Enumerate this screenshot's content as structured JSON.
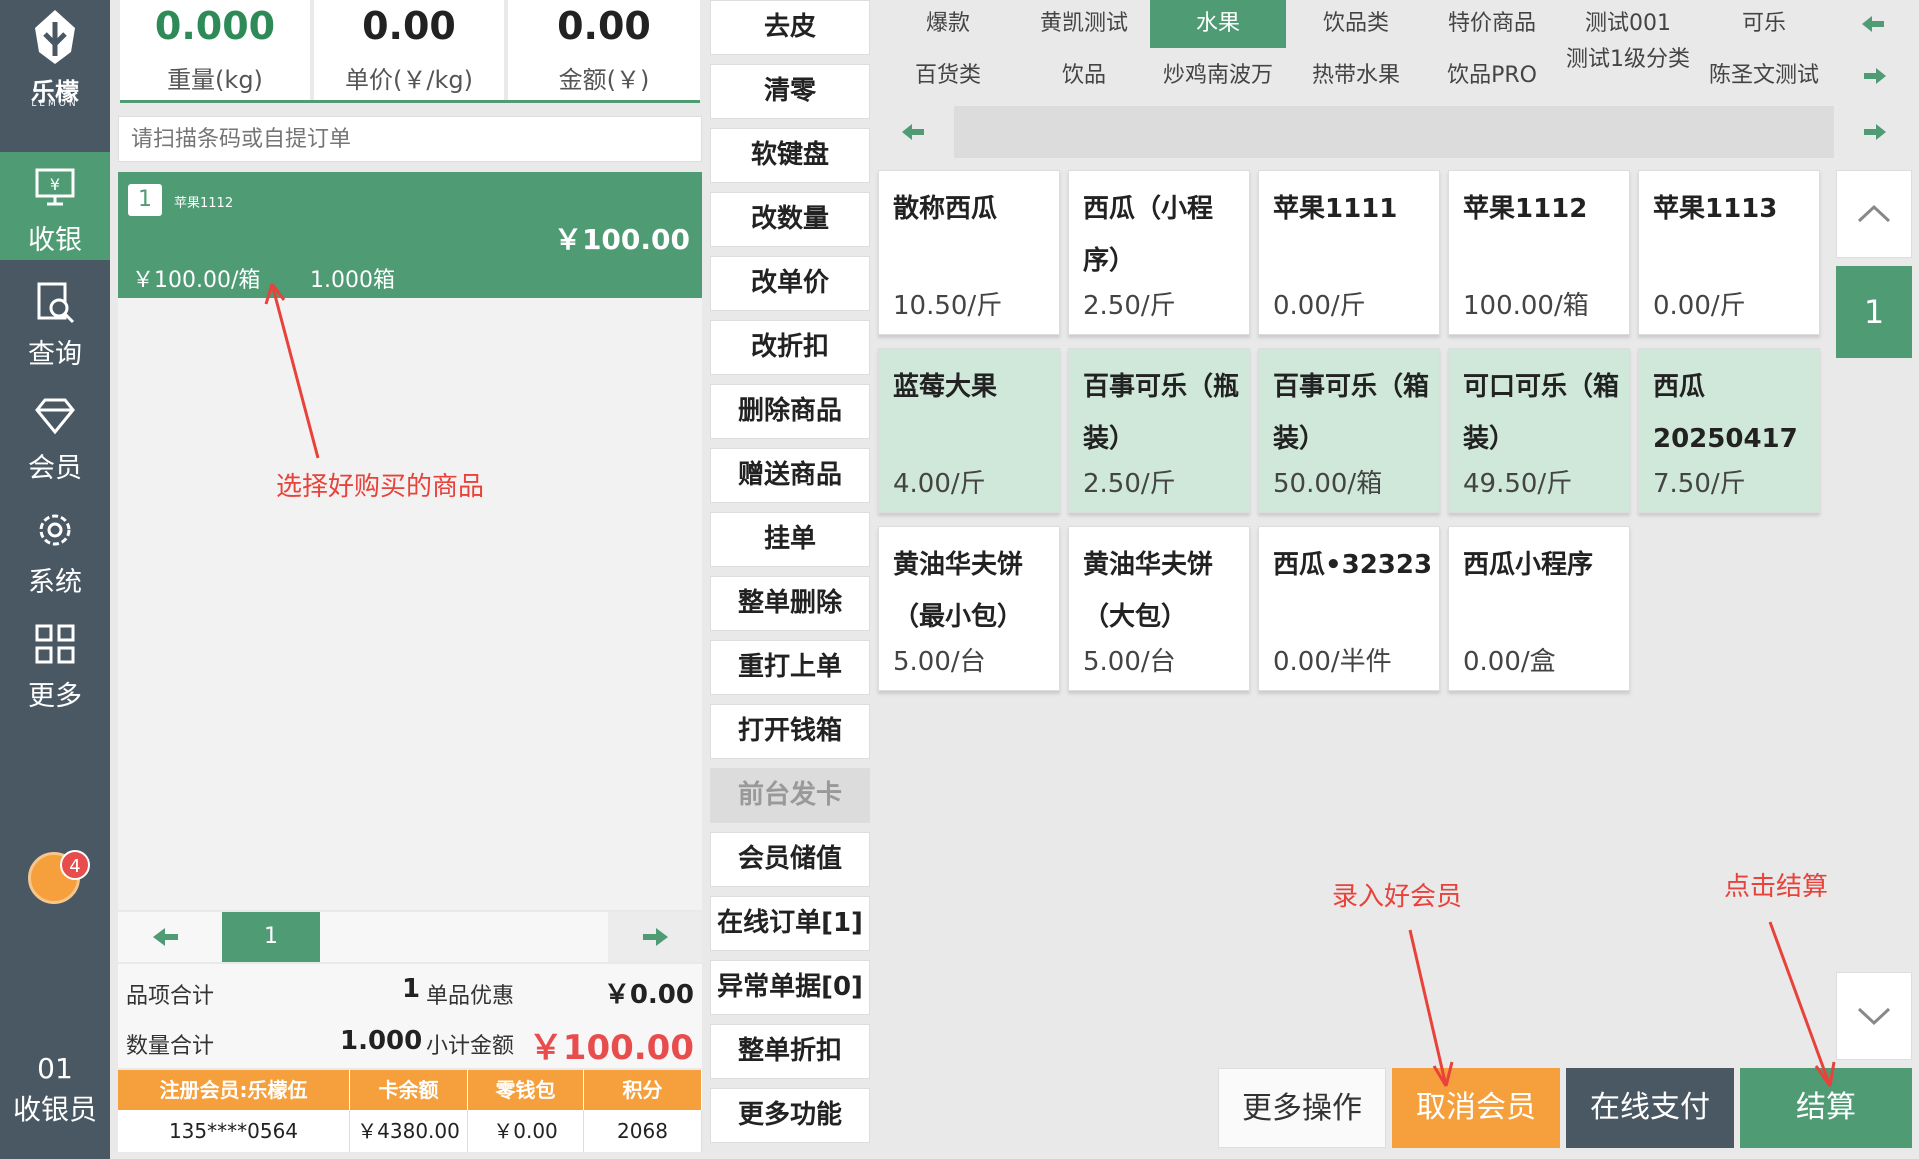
{
  "brand": {
    "name_cn": "乐檬",
    "name_en": "LEMON"
  },
  "nav": [
    {
      "label": "收银",
      "icon": "cashier-icon"
    },
    {
      "label": "查询",
      "icon": "query-icon"
    },
    {
      "label": "会员",
      "icon": "member-icon"
    },
    {
      "label": "系统",
      "icon": "settings-icon"
    },
    {
      "label": "更多",
      "icon": "more-icon"
    }
  ],
  "notification": {
    "count": "4"
  },
  "cashier": {
    "number": "01",
    "label": "收银员"
  },
  "metrics": {
    "weight": {
      "value": "0.000",
      "label": "重量(kg)"
    },
    "unit_price": {
      "value": "0.00",
      "label": "单价(￥/kg)"
    },
    "amount": {
      "value": "0.00",
      "label": "金额(￥)"
    }
  },
  "scan": {
    "placeholder": "请扫描条码或自提订单"
  },
  "order_item": {
    "index": "1",
    "name": "苹果1112",
    "total": "￥100.00",
    "price": "￥100.00/箱",
    "qty": "1.000箱"
  },
  "order_pager": {
    "page": "1"
  },
  "summary": {
    "items_label": "品项合计",
    "items_value": "1",
    "discount_label": "单品优惠",
    "discount_value": "￥0.00",
    "qty_label": "数量合计",
    "qty_value": "1.000",
    "subtotal_label": "小计金额",
    "subtotal_value": "￥100.00"
  },
  "member": {
    "headers": [
      "注册会员:乐檬伍",
      "卡余额",
      "零钱包",
      "积分"
    ],
    "values": [
      "135****0564",
      "￥4380.00",
      "￥0.00",
      "2068"
    ]
  },
  "functions": [
    "去皮",
    "清零",
    "软键盘",
    "改数量",
    "改单价",
    "改折扣",
    "删除商品",
    "赠送商品",
    "挂单",
    "整单删除",
    "重打上单",
    "打开钱箱",
    "前台发卡",
    "会员储值",
    "在线订单[1]",
    "异常单据[0]",
    "整单折扣",
    "更多功能"
  ],
  "categories_row1": [
    "爆款",
    "黄凯测试",
    "水果",
    "饮品类",
    "特价商品",
    "测试001",
    "可乐"
  ],
  "categories_row2": [
    "百货类",
    "饮品",
    "炒鸡南波万",
    "热带水果",
    "饮品PRO",
    "测试1级分类",
    "陈圣文测试"
  ],
  "products": [
    {
      "name": "散称西瓜",
      "price": "10.50/斤"
    },
    {
      "name": "西瓜（小程序）",
      "price": "2.50/斤"
    },
    {
      "name": "苹果1111",
      "price": "0.00/斤"
    },
    {
      "name": "苹果1112",
      "price": "100.00/箱"
    },
    {
      "name": "苹果1113",
      "price": "0.00/斤"
    },
    {
      "name": "蓝莓大果",
      "price": "4.00/斤"
    },
    {
      "name": "百事可乐（瓶装）",
      "price": "2.50/斤"
    },
    {
      "name": "百事可乐（箱装）",
      "price": "50.00/箱"
    },
    {
      "name": "可口可乐（箱装）",
      "price": "49.50/斤"
    },
    {
      "name": "西瓜20250417",
      "price": "7.50/斤"
    },
    {
      "name": "黄油华夫饼（最小包）",
      "price": "5.00/台"
    },
    {
      "name": "黄油华夫饼（大包）",
      "price": "5.00/台"
    },
    {
      "name": "西瓜•32323",
      "price": "0.00/半件"
    },
    {
      "name": "西瓜小程序",
      "price": "0.00/盒"
    }
  ],
  "product_page": "1",
  "actions": {
    "more": "更多操作",
    "cancel_member": "取消会员",
    "online_pay": "在线支付",
    "checkout": "结算"
  },
  "annotations": {
    "select": "选择好购买的商品",
    "member": "录入好会员",
    "checkout": "点击结算"
  },
  "colors": {
    "primary_green": "#4f9b74",
    "mint": "#cfe8d9",
    "orange": "#f5a03c",
    "sidebar": "#4a5863",
    "annotation_red": "#e8423a",
    "dark_button": "#4a5863"
  }
}
